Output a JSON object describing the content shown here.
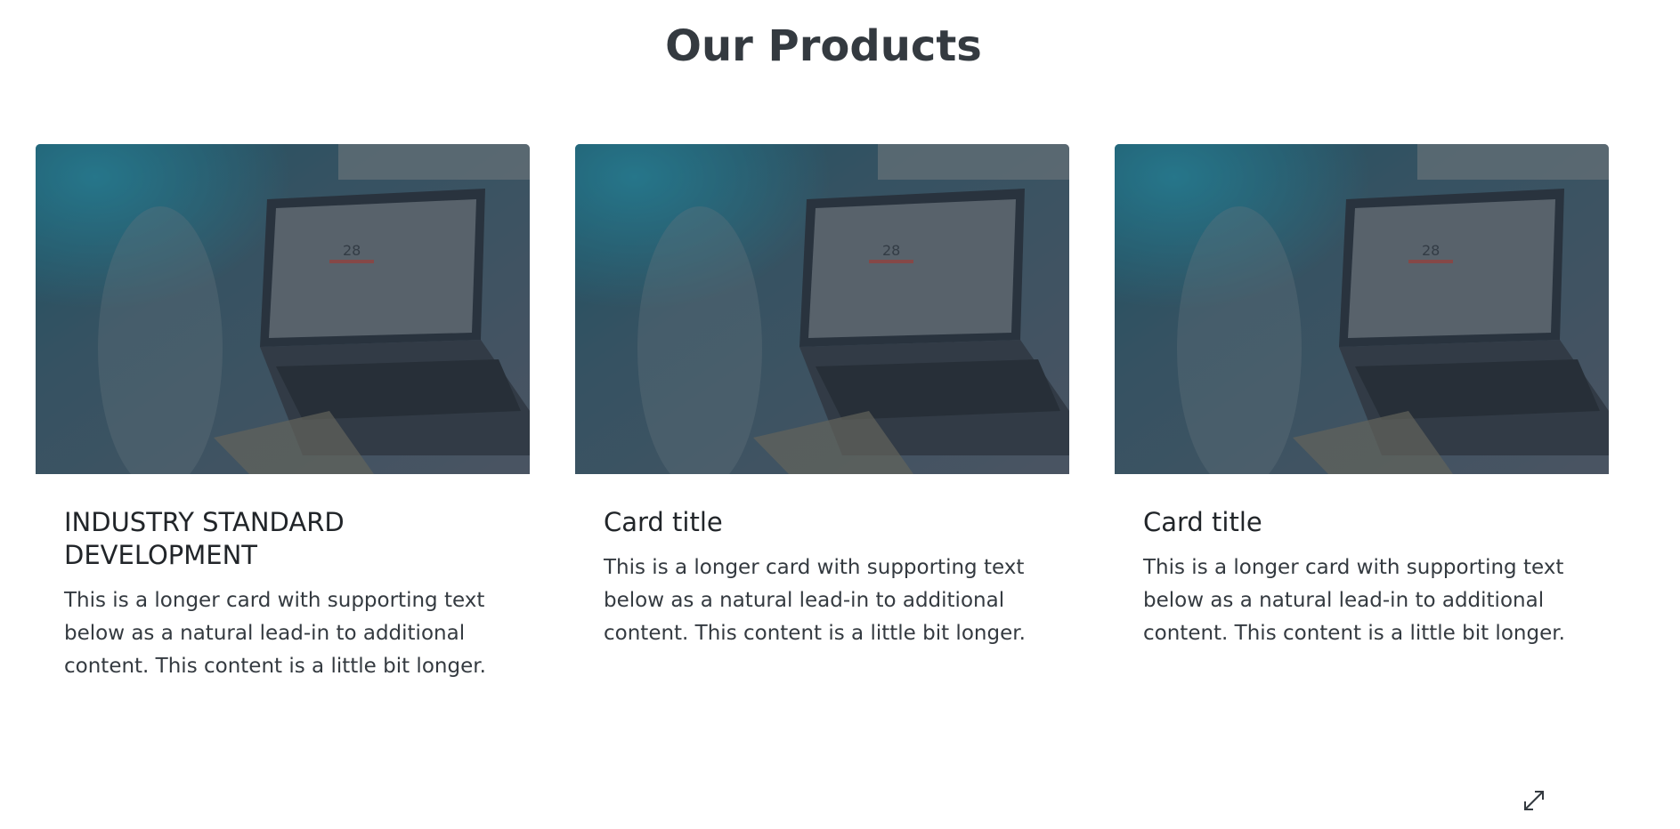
{
  "section": {
    "title": "Our Products"
  },
  "cards": [
    {
      "title": "INDUSTRY STANDARD DEVELOPMENT",
      "text": "This is a longer card with supporting text below as a natural lead-in to additional content. This content is a little bit longer.",
      "image_caption": "28"
    },
    {
      "title": "Card title",
      "text": "This is a longer card with supporting text below as a natural lead-in to additional content. This content is a little bit longer.",
      "image_caption": "28"
    },
    {
      "title": "Card title",
      "text": "This is a longer card with supporting text below as a natural lead-in to additional content. This content is a little bit longer.",
      "image_caption": "28"
    }
  ],
  "icons": {
    "corner": "expand-arrows-icon"
  }
}
